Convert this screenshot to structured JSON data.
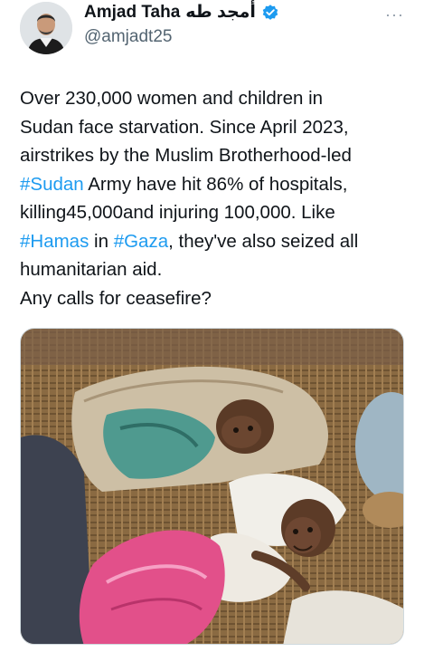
{
  "tweet": {
    "author": {
      "display_name": "Amjad Taha",
      "arabic_name": "أمجد طه",
      "handle": "@amjadt25",
      "verified": true
    },
    "more_label": "···",
    "text_segments": [
      {
        "text": "Over 230,000 women and children in\nSudan face starvation. Since April 2023,\nairstrikes by the Muslim Brotherhood-led\n",
        "hashtag": false
      },
      {
        "text": "#Sudan",
        "hashtag": true
      },
      {
        "text": " Army have hit 86% of hospitals,\nkilling45,000and injuring 100,000. Like\n",
        "hashtag": false
      },
      {
        "text": "#Hamas",
        "hashtag": true
      },
      {
        "text": " in ",
        "hashtag": false
      },
      {
        "text": "#Gaza",
        "hashtag": true
      },
      {
        "text": ", they've also seized all\nhumanitarian aid.\nAny calls for ceasefire?",
        "hashtag": false
      }
    ],
    "media": {
      "icon": "photo-of-two-infants-on-woven-mat"
    }
  },
  "colors": {
    "hashtag": "#1d9bf0",
    "verified_badge": "#1d9bf0",
    "handle": "#536471",
    "text": "#0f1419"
  }
}
